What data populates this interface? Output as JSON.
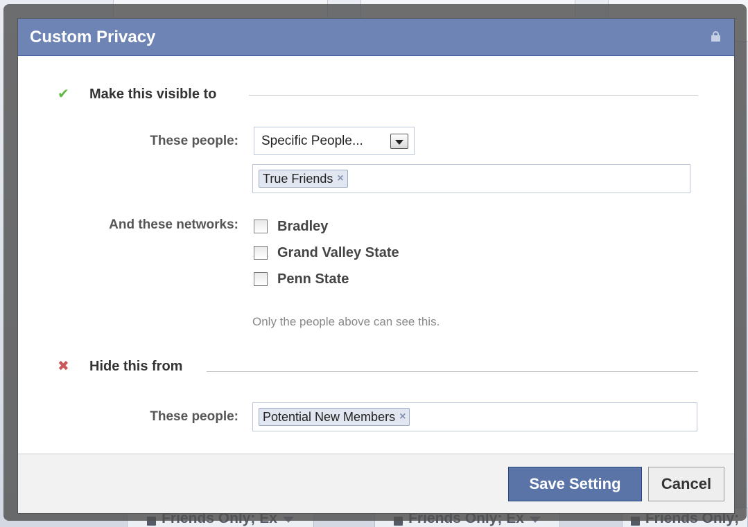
{
  "background": {
    "bottom_tabs": [
      "Friends Only; Ex",
      "Friends Only; Ex",
      "Friends Only;"
    ]
  },
  "dialog": {
    "title": "Custom Privacy",
    "header_icon": "lock-icon",
    "visible_section": {
      "icon": "check-icon",
      "title": "Make this visible to",
      "these_people_label": "These people:",
      "select_value": "Specific People...",
      "tokens": [
        "True Friends"
      ],
      "networks_label": "And these networks:",
      "networks": [
        {
          "label": "Bradley",
          "checked": false
        },
        {
          "label": "Grand Valley State",
          "checked": false
        },
        {
          "label": "Penn State",
          "checked": false
        }
      ],
      "hint": "Only the people above can see this."
    },
    "hide_section": {
      "icon": "x-icon",
      "title": "Hide this from",
      "these_people_label": "These people:",
      "tokens": [
        "Potential New Members"
      ]
    },
    "buttons": {
      "save": "Save Setting",
      "cancel": "Cancel"
    },
    "colors": {
      "header": "#6d84b4",
      "primary_button": "#5b74a8",
      "check": "#5fb846",
      "x": "#c8585a"
    }
  }
}
